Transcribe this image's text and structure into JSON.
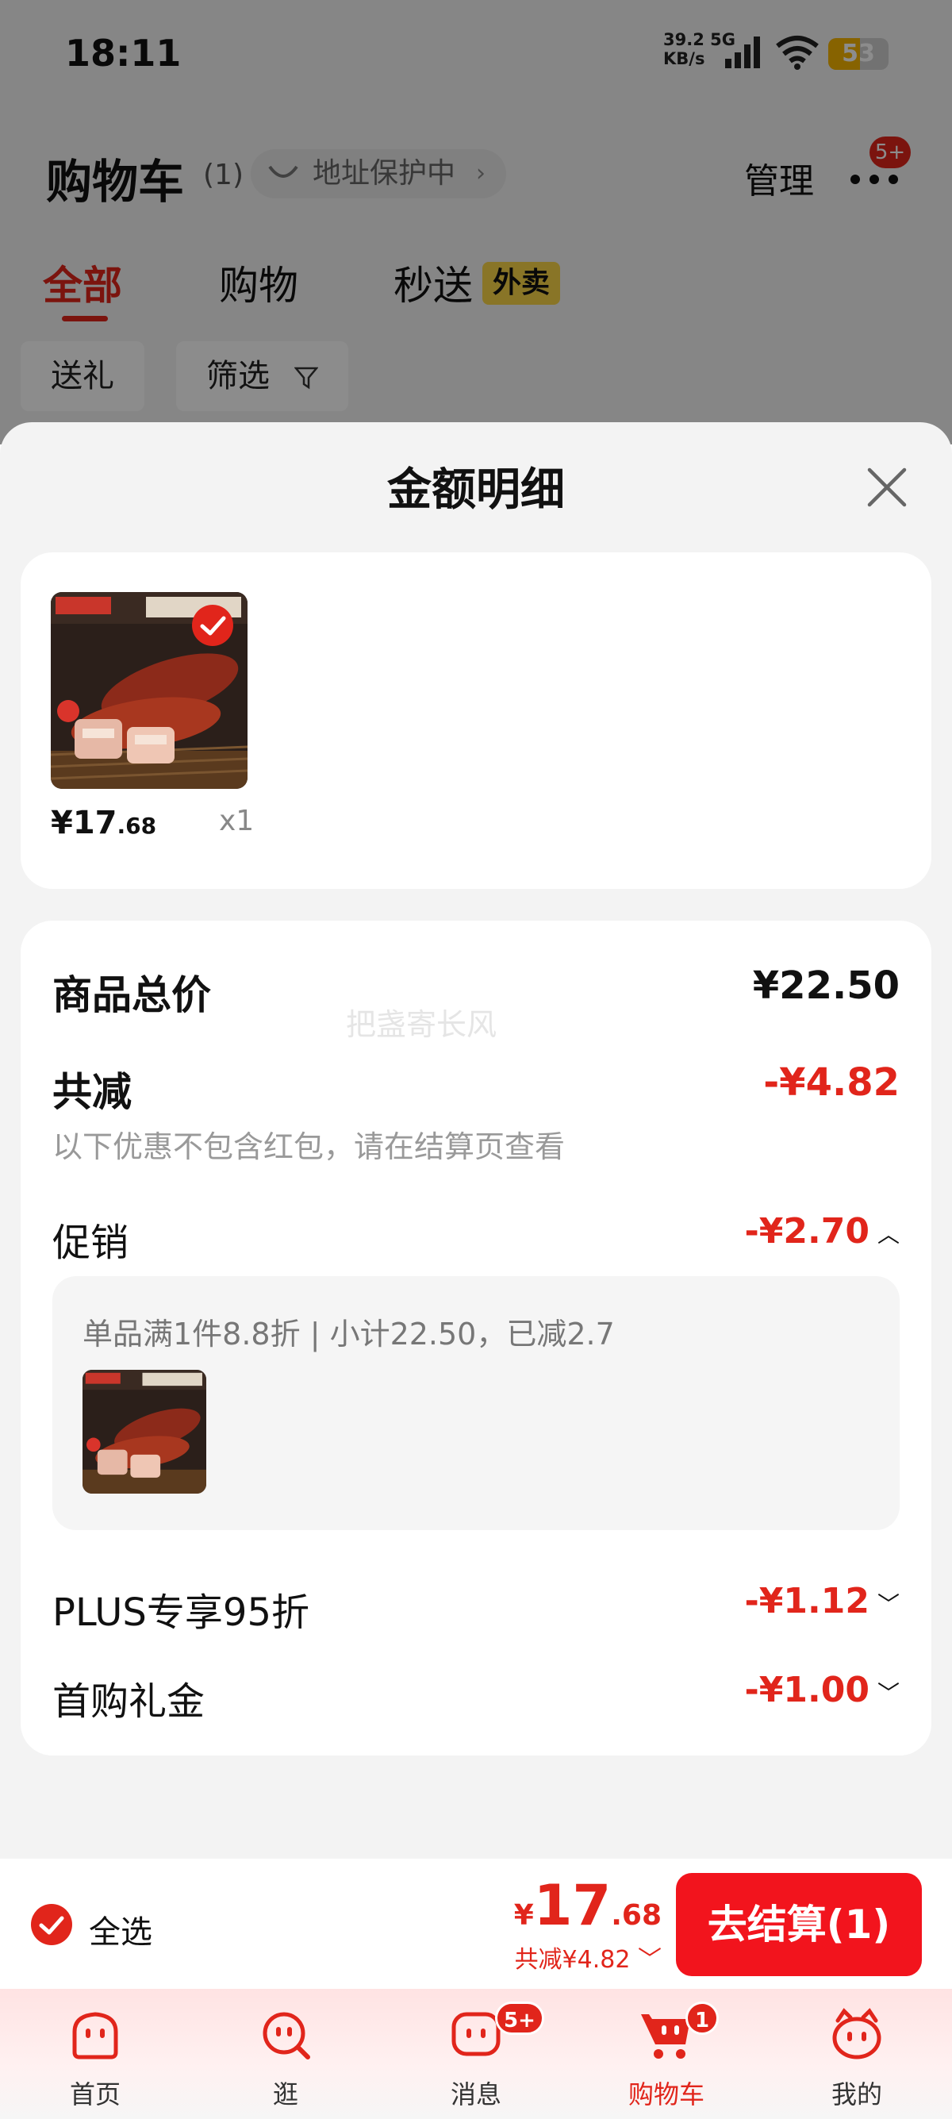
{
  "status_bar": {
    "time": "18:11",
    "net_speed_value": "39.2 5G",
    "net_speed_unit": "KB/s",
    "battery_level": "53",
    "battery_fraction": 0.53
  },
  "cart_header": {
    "title": "购物车",
    "count": "(1)",
    "address_protection": "地址保护中",
    "address_arrow": "›",
    "manage": "管理",
    "more_badge": "5+"
  },
  "tabs": [
    {
      "label": "全部"
    },
    {
      "label": "购物"
    },
    {
      "label": "秒送"
    }
  ],
  "tab_badge": "外卖",
  "chips": {
    "gift": "送礼",
    "filter": "筛选"
  },
  "sheet": {
    "title": "金额明细",
    "product": {
      "price_symbol": "¥",
      "price_int": "17",
      "price_dec": ".68",
      "qty": "x1"
    },
    "details": {
      "total_label": "商品总价",
      "total_value": "¥22.50",
      "reduce_label": "共减",
      "reduce_value": "-¥4.82",
      "reduce_note": "以下优惠不包含红包，请在结算页查看",
      "promo_label": "促销",
      "promo_value": "-¥2.70",
      "promo_text": "单品满1件8.8折 | 小计22.50，已减2.7",
      "plus_label": "PLUS专享95折",
      "plus_value": "-¥1.12",
      "first_label": "首购礼金",
      "first_value": "-¥1.00"
    },
    "watermark": "把盏寄长风"
  },
  "checkout": {
    "select_all": "全选",
    "currency": "¥",
    "price_int": "17",
    "price_dec": ".68",
    "discount": "共减¥4.82",
    "button": "去结算(1)"
  },
  "tabbar": [
    {
      "label": "首页",
      "icon": "home-icon"
    },
    {
      "label": "逛",
      "icon": "browse-icon"
    },
    {
      "label": "消息",
      "icon": "message-icon",
      "badge": "5+"
    },
    {
      "label": "购物车",
      "icon": "cart-icon",
      "badge": "1"
    },
    {
      "label": "我的",
      "icon": "profile-icon"
    }
  ],
  "colors": {
    "accent": "#e1251b",
    "checkout_button": "#f2141d",
    "tab_badge": "#f9d548"
  }
}
